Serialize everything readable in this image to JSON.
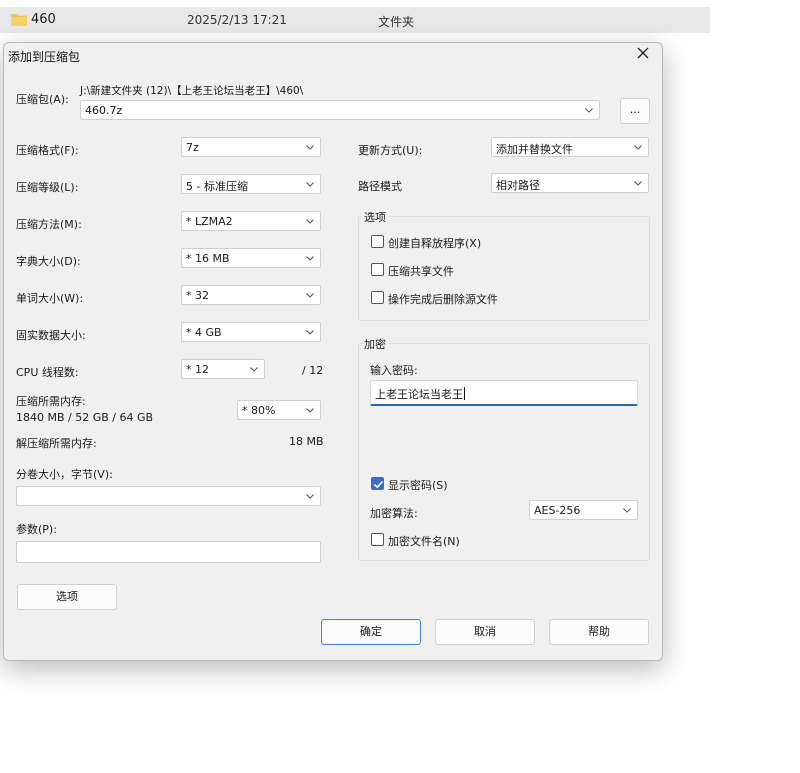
{
  "background_row": {
    "name": "460",
    "modified": "2025/2/13 17:21",
    "type": "文件夹"
  },
  "dialog": {
    "title": "添加到压缩包",
    "archive_label": "压缩包(A):",
    "archive_path": "J:\\新建文件夹 (12)\\【上老王论坛当老王】\\460\\",
    "archive_name": "460.7z",
    "browse_label": "...",
    "left": {
      "format_label": "压缩格式(F):",
      "format_value": "7z",
      "level_label": "压缩等级(L):",
      "level_value": "5 - 标准压缩",
      "method_label": "压缩方法(M):",
      "method_value": "*  LZMA2",
      "dict_label": "字典大小(D):",
      "dict_value": "*  16 MB",
      "word_label": "单词大小(W):",
      "word_value": "*  32",
      "solid_label": "固实数据大小:",
      "solid_value": "*  4 GB",
      "threads_label": "CPU 线程数:",
      "threads_value": "*  12",
      "threads_total": "/ 12",
      "mem_label": "压缩所需内存:",
      "mem_values": "1840 MB / 52 GB / 64 GB",
      "mem_percent": "*  80%",
      "decomp_label": "解压缩所需内存:",
      "decomp_value": "18 MB",
      "volume_label": "分卷大小，字节(V):",
      "volume_value": "",
      "params_label": "参数(P):",
      "params_value": "",
      "options_button": "选项"
    },
    "right": {
      "update_label": "更新方式(U):",
      "update_value": "添加并替换文件",
      "path_label": "路径模式",
      "path_value": "相对路径",
      "options_group": "选项",
      "opt_sfx": "创建自释放程序(X)",
      "opt_shared": "压缩共享文件",
      "opt_delete": "操作完成后删除源文件",
      "encrypt_group": "加密",
      "password_label": "输入密码:",
      "password_value": "上老王论坛当老王",
      "show_password": "显示密码(S)",
      "algo_label": "加密算法:",
      "algo_value": "AES-256",
      "encrypt_names": "加密文件名(N)"
    },
    "buttons": {
      "ok": "确定",
      "cancel": "取消",
      "help": "帮助"
    }
  }
}
